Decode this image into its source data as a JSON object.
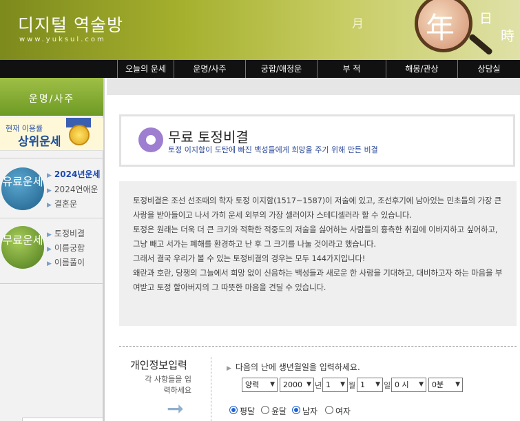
{
  "header": {
    "logo_title": "디지털 역술방",
    "logo_url": "www.yuksul.com",
    "deco_moon": "月",
    "deco_year": "年",
    "deco_day": "日",
    "deco_time": "時"
  },
  "topnav": {
    "items": [
      "오늘의 운세",
      "운명/사주",
      "궁합/애정운",
      "부 적",
      "해몽/관상",
      "상담실"
    ]
  },
  "sidebar": {
    "section_title": "운명/사주",
    "banner_small": "현재 이용률",
    "banner_big": "상위운세",
    "group1_badge": "유료운세",
    "group1_links": [
      "2024년운세",
      "2024연애운",
      "결혼운"
    ],
    "group2_badge": "무료운세",
    "group2_links": [
      "토정비결",
      "이름궁합",
      "이름풀이"
    ]
  },
  "title": {
    "main": "무료 토정비결",
    "sub": "토정 이지함이 도탄에 빠진 백성들에게 희망을 주기 위해 만든 비결"
  },
  "description": {
    "p1": "토정비결은 조선 선조때의 학자 토정 이지함(1517~1587)이 저술에 있고, 조선후기에 남아있는 민초들의 가장 큰 사랑을 받아들이고 나서 가히 운세 외부의 가장 셀러이자 스테디셀러라 할 수 있습니다.",
    "p2": "토정은 원래는 더욱 더 큰 크기와 적확한 적중도의 저술을 싫어하는 사람들의 흉측한 취길에 이바지하고 싶어하고, 그냥 빼고 서가는 폐해를 환경하고 난 후 그 크기를 나눌 것이라고 했습니다.",
    "p3": "그래서 결국 우리가 볼 수 있는 토정비결의 경우는 모두 144가지입니다!",
    "p4": "왜란과 호란, 당쟁의 그늘에서 희망 없이 신음하는 백성들과 새로운 한 사람을 기대하고, 대비하고자 하는 마음을 부여받고 토정 할아버지의 그 따뜻한 마음을 견딜 수 있습니다."
  },
  "form": {
    "title": "개인정보입력",
    "subtitle": "각 사항들을 입력하세요",
    "prompt": "다음의 난에 생년월일을 입력하세요.",
    "calendar_type": "양력",
    "year": "2000",
    "year_unit": "년",
    "month": "1",
    "month_unit": "월",
    "day": "1",
    "day_unit": "일",
    "hour": "0 시",
    "minute": "0분",
    "leap_options": [
      "평달",
      "윤달"
    ],
    "leap_selected": "평달",
    "gender_options": [
      "남자",
      "여자"
    ],
    "gender_selected": "남자"
  }
}
